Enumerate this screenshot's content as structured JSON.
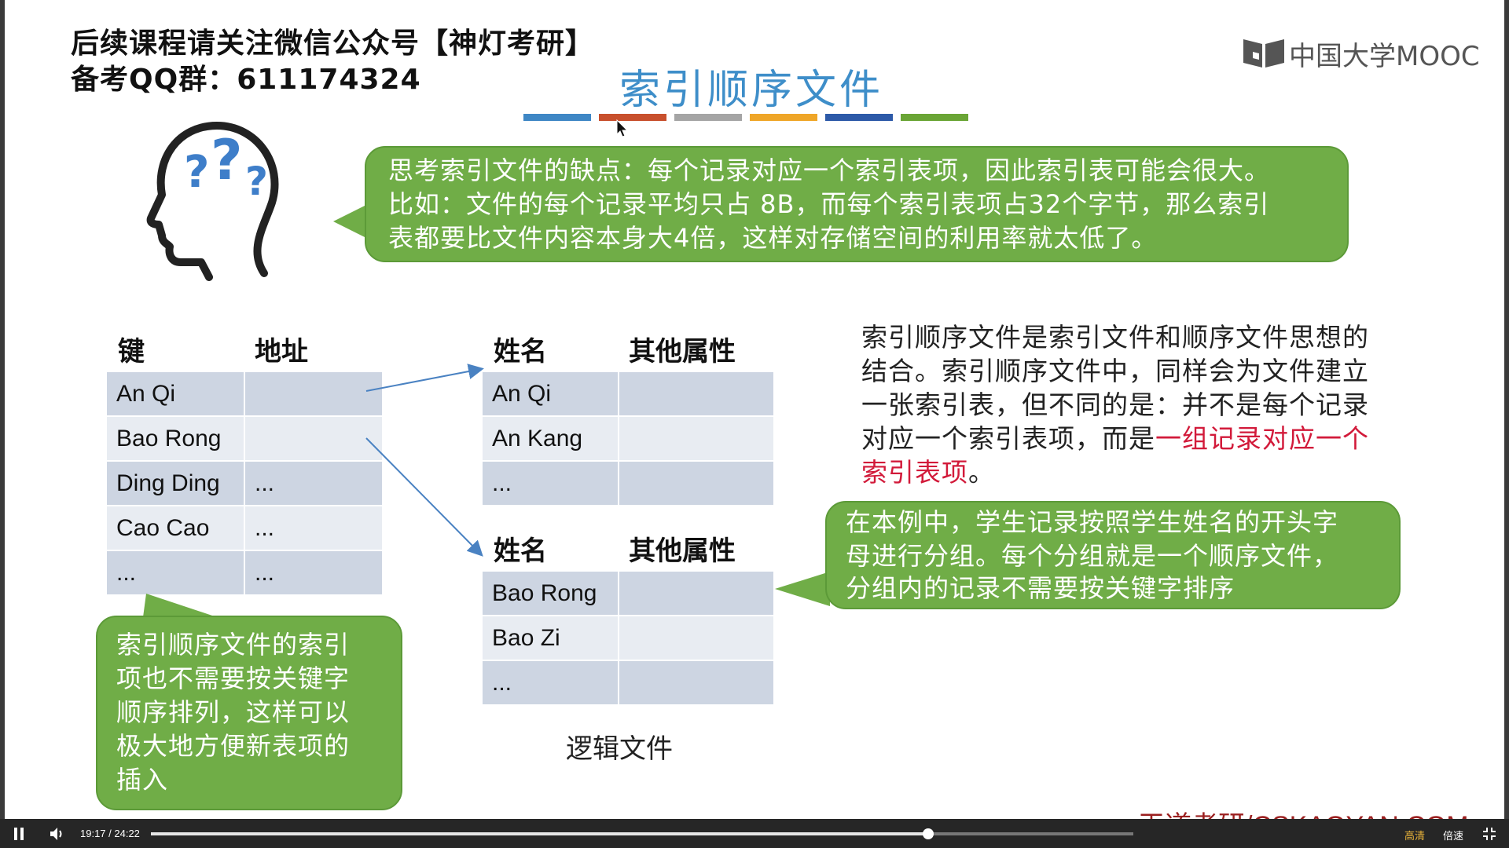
{
  "header_note": {
    "line1": "后续课程请关注微信公众号【神灯考研】",
    "line2": "备考QQ群：611174324"
  },
  "slide": {
    "title": "索引顺序文件",
    "logo_text": "中国大学MOOC",
    "color_bars": [
      "#3f87c5",
      "#c8502d",
      "#a5a5a5",
      "#efa628",
      "#2d5aa8",
      "#6aa536"
    ],
    "thought_bubble": {
      "line1": "思考索引文件的缺点：每个记录对应一个索引表项，因此索引表可能会很大。",
      "line2": "比如：文件的每个记录平均只占 8B，而每个索引表项占32个字节，那么索引",
      "line3": "表都要比文件内容本身大4倍，这样对存储空间的利用率就太低了。"
    },
    "index_table": {
      "headers": [
        "键",
        "地址"
      ],
      "rows": [
        [
          "An Qi",
          ""
        ],
        [
          "Bao Rong",
          ""
        ],
        [
          "Ding Ding",
          "..."
        ],
        [
          "Cao Cao",
          "..."
        ],
        [
          "...",
          "..."
        ]
      ]
    },
    "group1": {
      "headers": [
        "姓名",
        "其他属性"
      ],
      "rows": [
        [
          "An Qi",
          ""
        ],
        [
          "An Kang",
          ""
        ],
        [
          "...",
          ""
        ]
      ]
    },
    "group2": {
      "headers": [
        "姓名",
        "其他属性"
      ],
      "rows": [
        [
          "Bao Rong",
          ""
        ],
        [
          "Bao Zi",
          ""
        ],
        [
          "...",
          ""
        ]
      ]
    },
    "logic_file_label": "逻辑文件",
    "description": {
      "line1": "索引顺序文件是索引文件和顺序文件思想的",
      "line2": "结合。索引顺序文件中，同样会为文件建立",
      "line3": "一张索引表，但不同的是：并不是每个记录",
      "line4_plain": "对应一个索引表项，而是",
      "line4_red": "一组记录对应一个",
      "line5_red": "索引表项",
      "line5_plain": "。"
    },
    "example_bubble": {
      "line1": "在本例中，学生记录按照学生姓名的开头字",
      "line2": "母进行分组。每个分组就是一个顺序文件，",
      "line3": "分组内的记录不需要按关键字排序"
    },
    "left_bubble": {
      "line1": "索引顺序文件的索引",
      "line2": "项也不需要按关键字",
      "line3": "顺序排列，这样可以",
      "line4": "极大地方便新表项的",
      "line5": "插入"
    },
    "watermark": "王道考研/CSKAOYAN.COM"
  },
  "player": {
    "time": "19:17 / 24:22",
    "progress": 0.791,
    "quality_label": "高清",
    "speed_label": "倍速"
  }
}
